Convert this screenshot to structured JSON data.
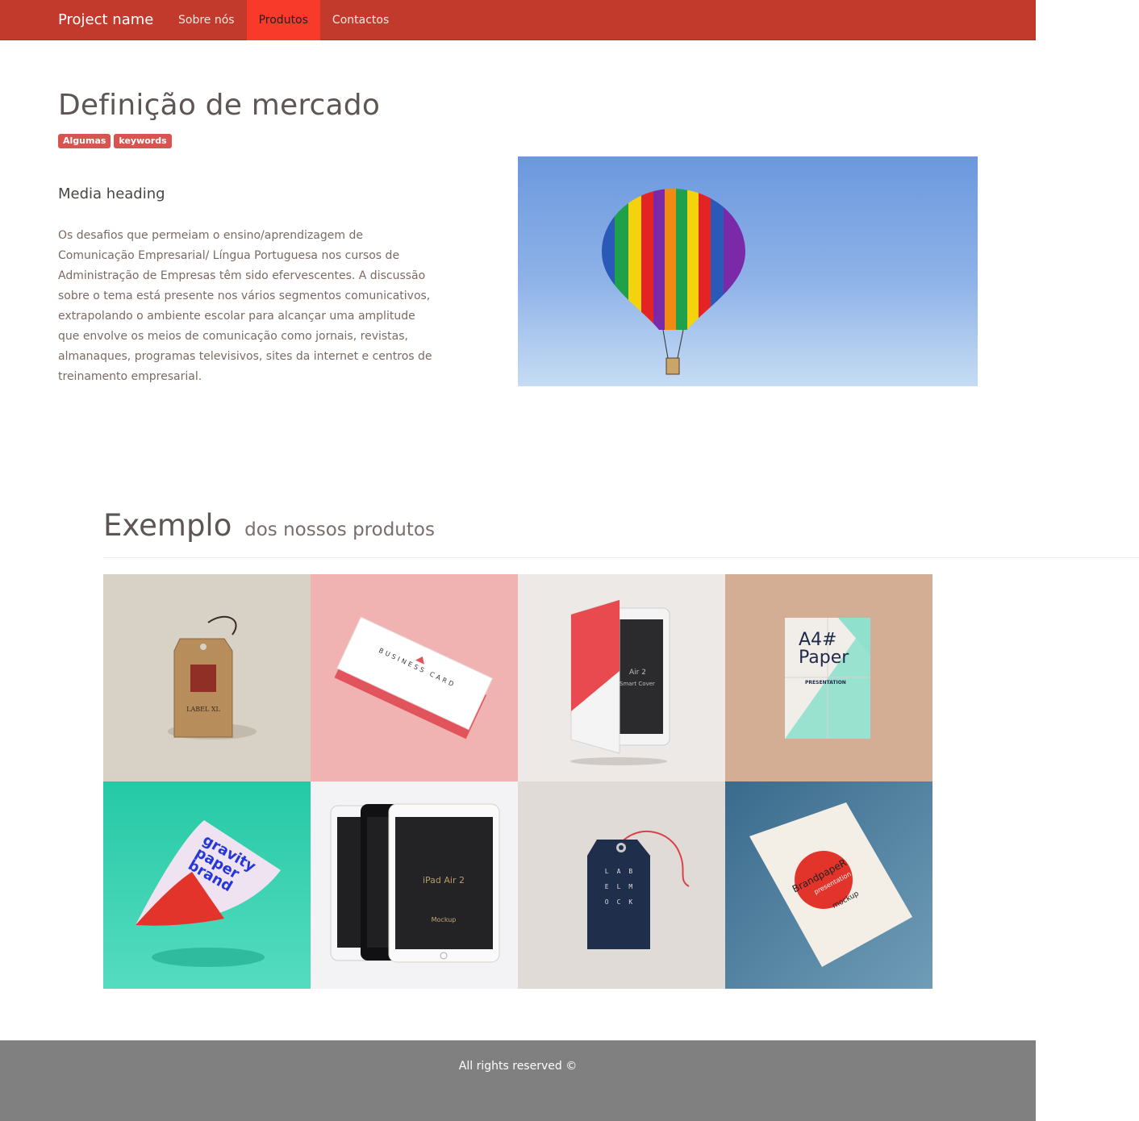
{
  "navbar": {
    "brand": "Project name",
    "items": [
      {
        "label": "Sobre nós",
        "active": false
      },
      {
        "label": "Produtos",
        "active": true
      },
      {
        "label": "Contactos",
        "active": false
      }
    ]
  },
  "hero": {
    "title": "Definição de mercado",
    "labels": [
      "Algumas",
      "keywords"
    ],
    "media_heading": "Media heading",
    "body": "Os desafios que permeiam o ensino/aprendizagem de Comunicação Empresarial/ Língua Portuguesa nos cursos de Administração de Empresas têm sido efervescentes. A discussão sobre o tema está presente nos vários segmentos comunicativos, extrapolando o ambiente escolar para alcançar uma amplitude que envolve os meios de comunicação como jornais, revistas, almanaques, programas televisivos, sites da internet e centros de treinamento empresarial."
  },
  "products": {
    "title": "Exemplo",
    "subtitle": "dos nossos produtos",
    "tiles": [
      {
        "text": "LABEL XL"
      },
      {
        "text": "BUSINESS CARD"
      },
      {
        "text": "Air 2",
        "text2": "Smart Cover"
      },
      {
        "text": "A4#",
        "text2": "Paper",
        "text3": "PRESENTATION"
      },
      {
        "text": "gravity",
        "text2": "paper",
        "text3": "brand"
      },
      {
        "text": "iPad Air 2",
        "text2": "Mockup"
      },
      {
        "text": "LAB",
        "text2": "ELM",
        "text3": "OCK"
      },
      {
        "text": "BrandpapeR",
        "text2": "presentation",
        "text3": "mockup"
      }
    ]
  },
  "footer": {
    "text": "All rights reserved ©"
  },
  "colors": {
    "navbar": "#c23a2c",
    "nav_active": "#f83a2a",
    "label": "#d9534f",
    "footer": "#808080"
  }
}
